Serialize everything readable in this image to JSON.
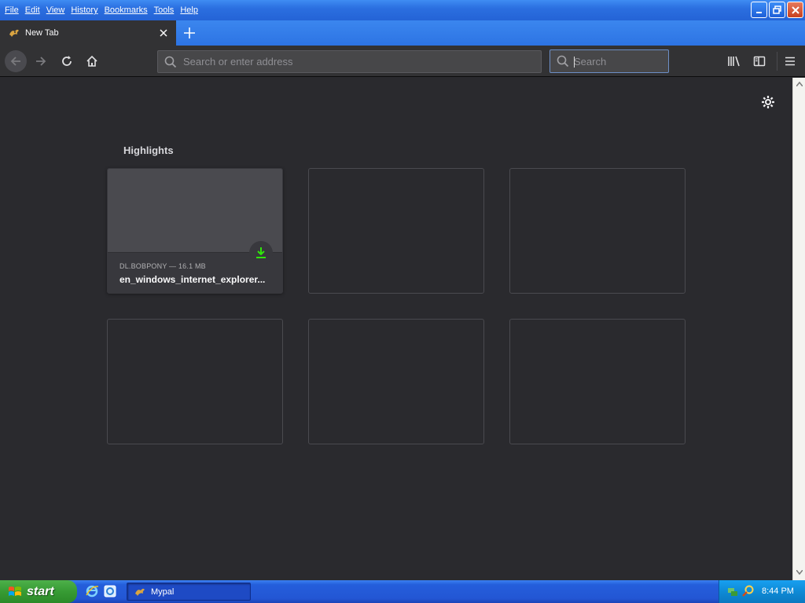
{
  "menu": [
    "File",
    "Edit",
    "View",
    "History",
    "Bookmarks",
    "Tools",
    "Help"
  ],
  "tab": {
    "title": "New Tab"
  },
  "navbar": {
    "url_placeholder": "Search or enter address",
    "search_placeholder": "Search"
  },
  "content": {
    "section_title": "Highlights",
    "highlight": {
      "meta": "DL.BOBPONY — 16.1 MB",
      "name": "en_windows_internet_explorer..."
    }
  },
  "taskbar": {
    "start_label": "start",
    "task_label": "Mypal",
    "clock": "8:44 PM"
  },
  "colors": {
    "background": "#2a2a2e",
    "accent_green": "#30e60b",
    "xp_blue": "#245edb"
  }
}
